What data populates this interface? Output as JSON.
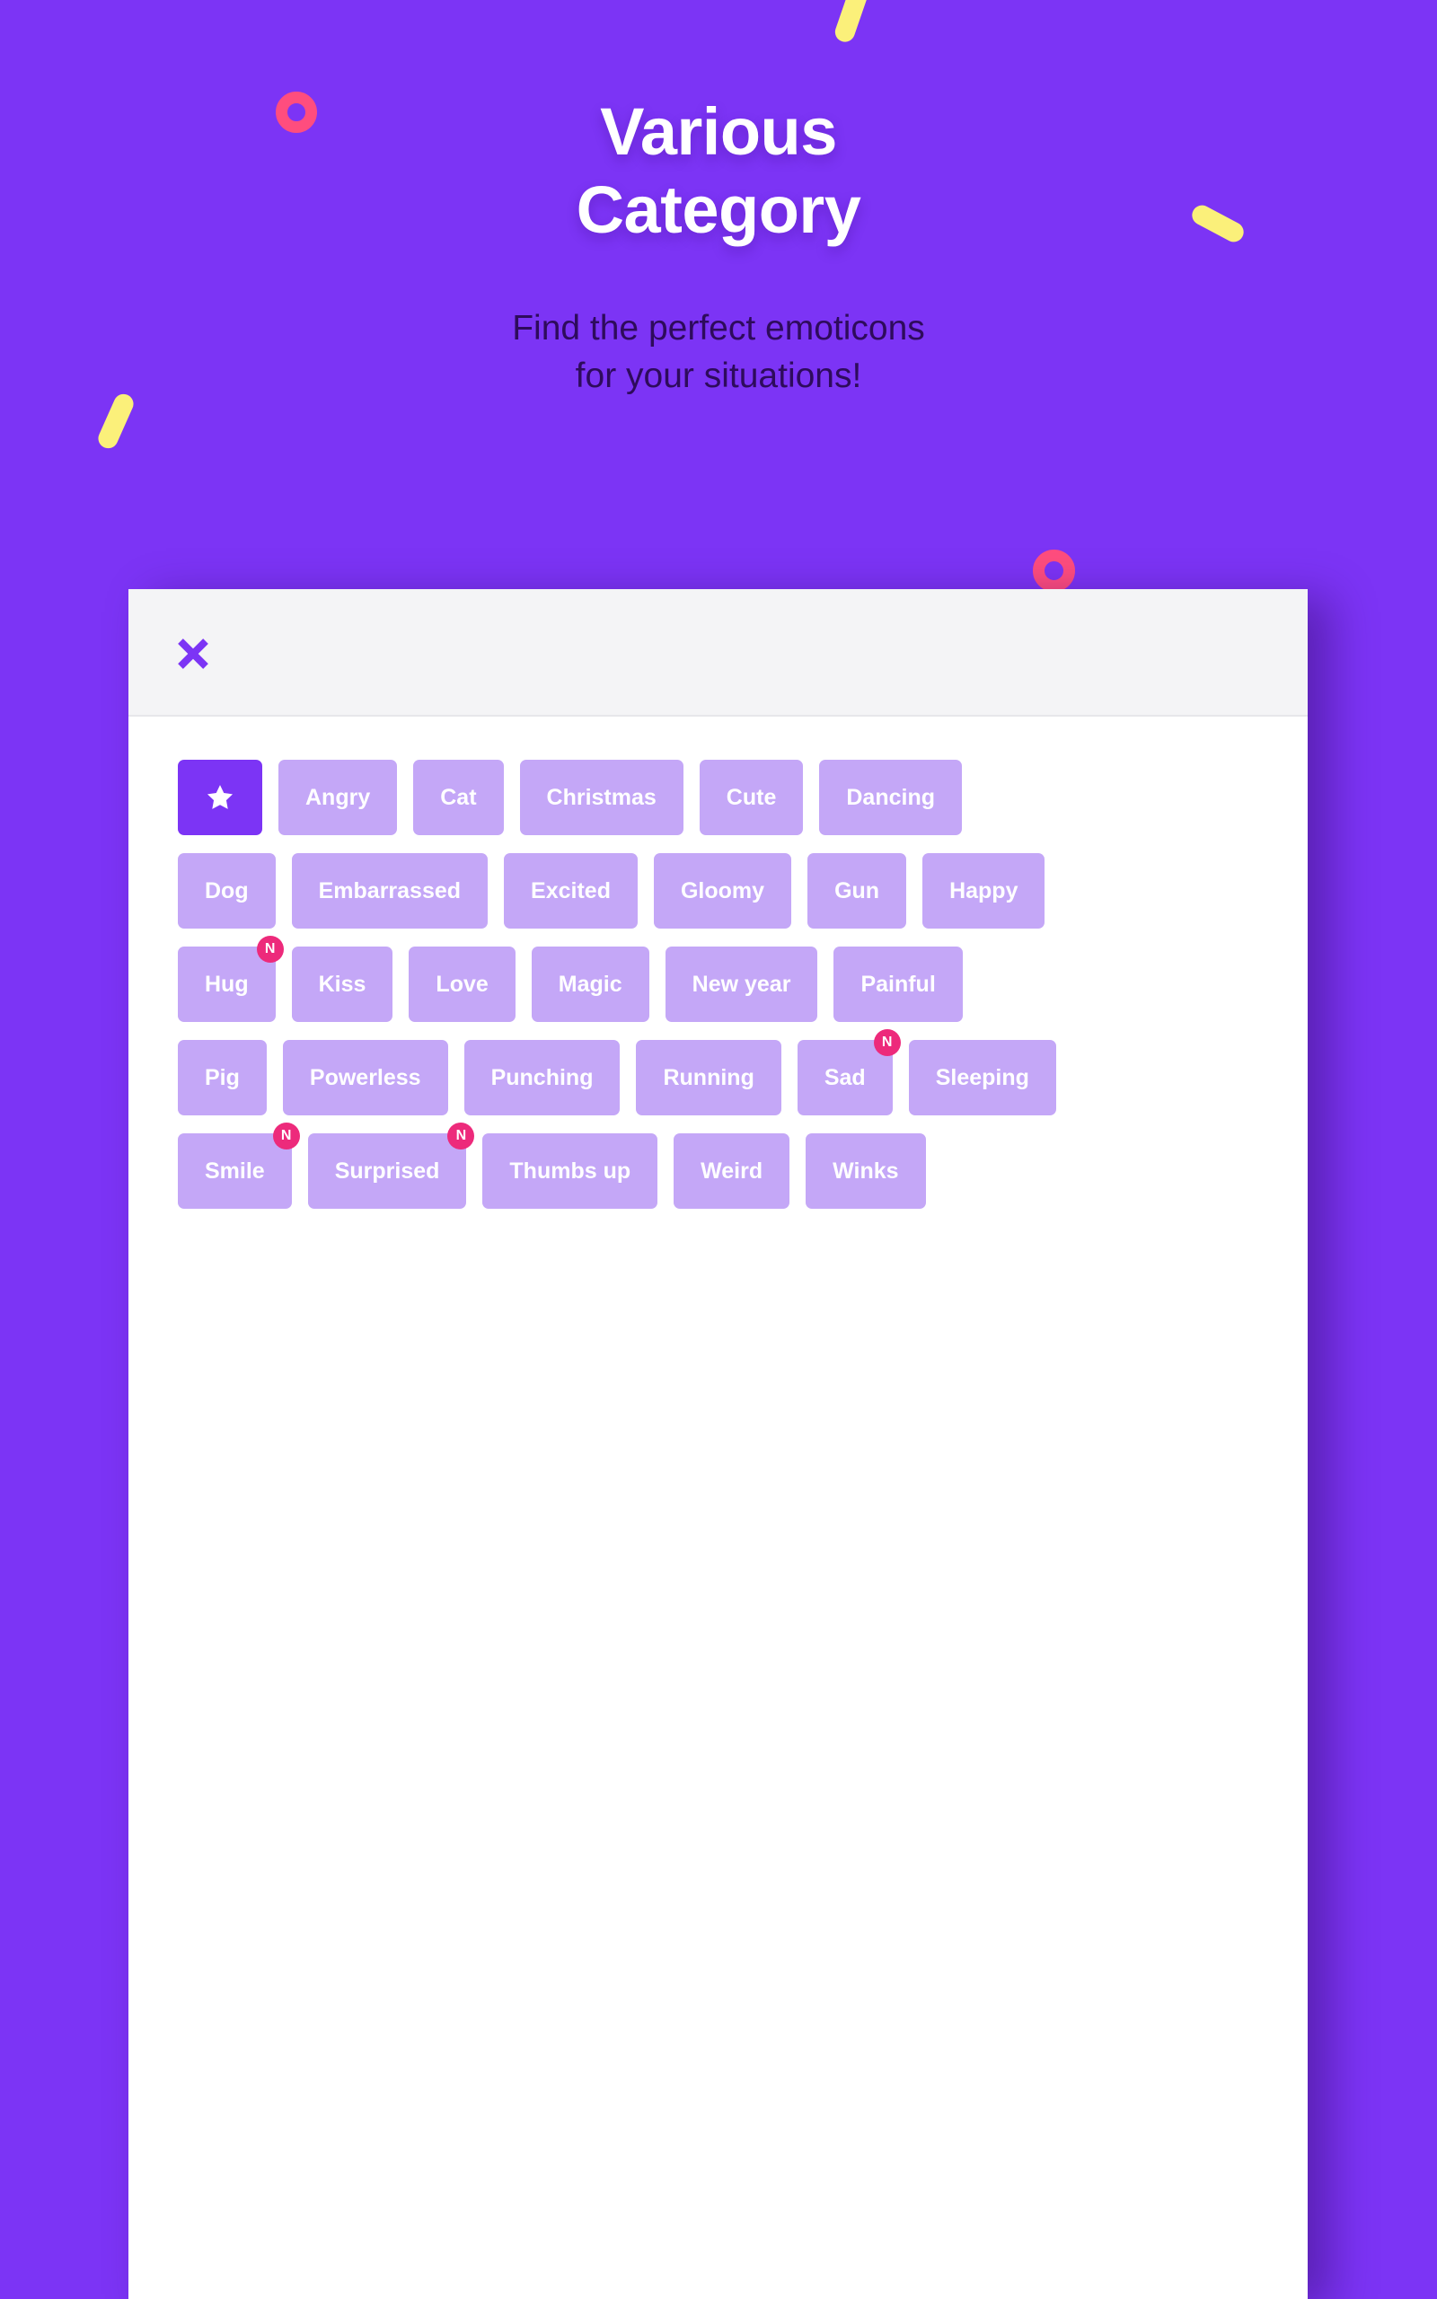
{
  "theme": {
    "background_purple": "#7c34f5",
    "accent_pink": "#ff4d7e",
    "accent_yellow": "#fbf07a",
    "chip_purple": "#c4a7f7",
    "chip_active_purple": "#7c34f5",
    "badge_pink": "#ed2a7b",
    "panel_white": "#ffffff",
    "panel_header_gray": "#f4f4f6",
    "subtitle_dark": "#2e0b5c"
  },
  "hero": {
    "title_line1": "Various",
    "title_line2": "Category",
    "subtitle_line1": "Find the perfect emoticons",
    "subtitle_line2": "for your situations!"
  },
  "sheet": {
    "close_label": "✕"
  },
  "categories": {
    "rows": [
      [
        {
          "label": "",
          "icon": "star-icon",
          "active": true,
          "badge": ""
        },
        {
          "label": "Angry",
          "icon": "",
          "active": false,
          "badge": ""
        },
        {
          "label": "Cat",
          "icon": "",
          "active": false,
          "badge": ""
        },
        {
          "label": "Christmas",
          "icon": "",
          "active": false,
          "badge": ""
        },
        {
          "label": "Cute",
          "icon": "",
          "active": false,
          "badge": ""
        },
        {
          "label": "Dancing",
          "icon": "",
          "active": false,
          "badge": ""
        }
      ],
      [
        {
          "label": "Dog",
          "icon": "",
          "active": false,
          "badge": ""
        },
        {
          "label": "Embarrassed",
          "icon": "",
          "active": false,
          "badge": ""
        },
        {
          "label": "Excited",
          "icon": "",
          "active": false,
          "badge": ""
        },
        {
          "label": "Gloomy",
          "icon": "",
          "active": false,
          "badge": ""
        },
        {
          "label": "Gun",
          "icon": "",
          "active": false,
          "badge": ""
        },
        {
          "label": "Happy",
          "icon": "",
          "active": false,
          "badge": ""
        }
      ],
      [
        {
          "label": "Hug",
          "icon": "",
          "active": false,
          "badge": "N"
        },
        {
          "label": "Kiss",
          "icon": "",
          "active": false,
          "badge": ""
        },
        {
          "label": "Love",
          "icon": "",
          "active": false,
          "badge": ""
        },
        {
          "label": "Magic",
          "icon": "",
          "active": false,
          "badge": ""
        },
        {
          "label": "New year",
          "icon": "",
          "active": false,
          "badge": ""
        },
        {
          "label": "Painful",
          "icon": "",
          "active": false,
          "badge": ""
        }
      ],
      [
        {
          "label": "Pig",
          "icon": "",
          "active": false,
          "badge": ""
        },
        {
          "label": "Powerless",
          "icon": "",
          "active": false,
          "badge": ""
        },
        {
          "label": "Punching",
          "icon": "",
          "active": false,
          "badge": ""
        },
        {
          "label": "Running",
          "icon": "",
          "active": false,
          "badge": ""
        },
        {
          "label": "Sad",
          "icon": "",
          "active": false,
          "badge": "N"
        },
        {
          "label": "Sleeping",
          "icon": "",
          "active": false,
          "badge": ""
        }
      ],
      [
        {
          "label": "Smile",
          "icon": "",
          "active": false,
          "badge": "N"
        },
        {
          "label": "Surprised",
          "icon": "",
          "active": false,
          "badge": "N"
        },
        {
          "label": "Thumbs up",
          "icon": "",
          "active": false,
          "badge": ""
        },
        {
          "label": "Weird",
          "icon": "",
          "active": false,
          "badge": ""
        },
        {
          "label": "Winks",
          "icon": "",
          "active": false,
          "badge": ""
        }
      ]
    ]
  },
  "decorations": [
    {
      "name": "ring-pink-top-left",
      "shape": "ring",
      "color": "#ff4d7e"
    },
    {
      "name": "ring-pink-mid-right",
      "shape": "ring",
      "color": "#ff4d7e"
    },
    {
      "name": "stroke-yellow-top",
      "shape": "stroke",
      "color": "#fbf07a"
    },
    {
      "name": "stroke-yellow-right",
      "shape": "stroke",
      "color": "#fbf07a"
    },
    {
      "name": "stroke-yellow-left",
      "shape": "stroke",
      "color": "#fbf07a"
    }
  ]
}
